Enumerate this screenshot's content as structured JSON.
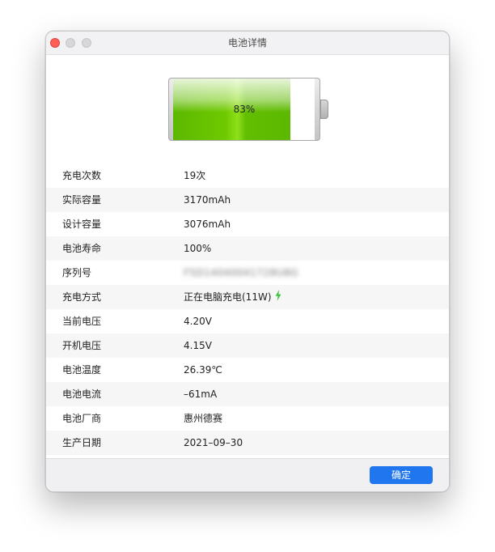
{
  "window": {
    "title": "电池详情"
  },
  "battery": {
    "level_percent": 83,
    "level_label": "83%",
    "fill_color": "#5cb800"
  },
  "details": [
    {
      "label": "充电次数",
      "value": "19次"
    },
    {
      "label": "实际容量",
      "value": "3170mAh"
    },
    {
      "label": "设计容量",
      "value": "3076mAh"
    },
    {
      "label": "电池寿命",
      "value": "100%"
    },
    {
      "label": "序列号",
      "value": "F5D14040041728U8G",
      "obscured": true
    },
    {
      "label": "充电方式",
      "value": "正在电脑充电(11W)",
      "icon": "lightning-bolt-icon"
    },
    {
      "label": "当前电压",
      "value": "4.20V"
    },
    {
      "label": "开机电压",
      "value": "4.15V"
    },
    {
      "label": "电池温度",
      "value": "26.39℃"
    },
    {
      "label": "电池电流",
      "value": "–61mA"
    },
    {
      "label": "电池厂商",
      "value": "惠州德赛"
    },
    {
      "label": "生产日期",
      "value": "2021–09–30"
    }
  ],
  "footer": {
    "ok_label": "确定"
  },
  "colors": {
    "accent": "#1f76ee",
    "close": "#fe5f57",
    "bolt": "#3cc33c"
  }
}
